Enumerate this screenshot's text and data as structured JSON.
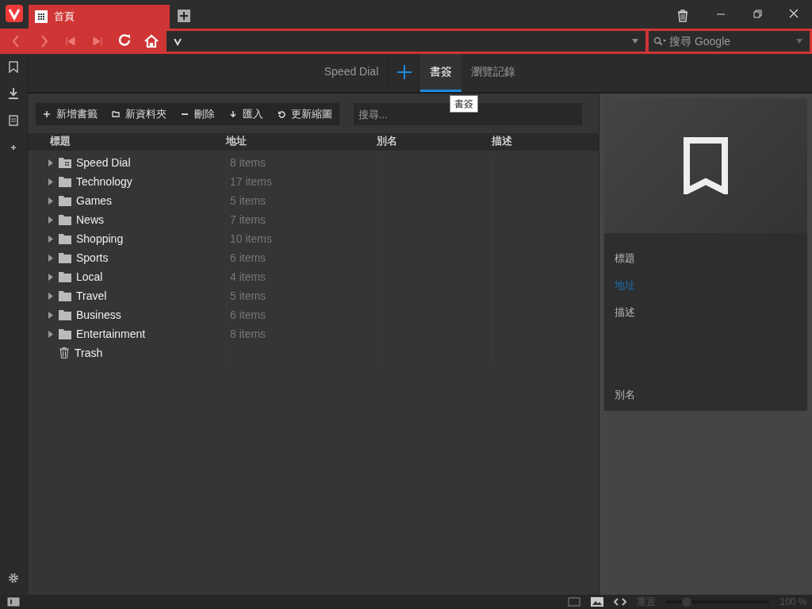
{
  "browser_tab": {
    "title": "首頁",
    "selected": true
  },
  "search_engine": {
    "placeholder": "搜尋 Google"
  },
  "panel_tabs": [
    {
      "label": "Speed Dial",
      "selected": false
    },
    {
      "label": "書簽",
      "selected": true
    },
    {
      "label": "瀏覽記錄",
      "selected": false
    }
  ],
  "tooltip": "書簽",
  "toolbar": [
    {
      "label": "新增書籤",
      "kind": "add"
    },
    {
      "label": "新資料夾",
      "kind": "folder"
    },
    {
      "label": "刪除",
      "kind": "delete"
    },
    {
      "label": "匯入",
      "kind": "import"
    },
    {
      "label": "更新縮圖",
      "kind": "refresh"
    }
  ],
  "bookmark_search": {
    "placeholder": "搜尋..."
  },
  "columns": [
    "標題",
    "地址",
    "別名",
    "描述"
  ],
  "rows": [
    {
      "title": "Speed Dial",
      "count": "8 items",
      "kind": "speeddial",
      "expanded": false
    },
    {
      "title": "Technology",
      "count": "17 items",
      "kind": "folder",
      "expanded": false
    },
    {
      "title": "Games",
      "count": "5 items",
      "kind": "folder",
      "expanded": false
    },
    {
      "title": "News",
      "count": "7 items",
      "kind": "folder",
      "expanded": false
    },
    {
      "title": "Shopping",
      "count": "10 items",
      "kind": "folder",
      "expanded": false
    },
    {
      "title": "Sports",
      "count": "6 items",
      "kind": "folder",
      "expanded": false
    },
    {
      "title": "Local",
      "count": "4 items",
      "kind": "folder",
      "expanded": false
    },
    {
      "title": "Travel",
      "count": "5 items",
      "kind": "folder",
      "expanded": false
    },
    {
      "title": "Business",
      "count": "6 items",
      "kind": "folder",
      "expanded": false
    },
    {
      "title": "Entertainment",
      "count": "8 items",
      "kind": "folder",
      "expanded": false
    },
    {
      "title": "Trash",
      "kind": "trash"
    }
  ],
  "details": [
    {
      "label": "標題",
      "selected": false
    },
    {
      "label": "地址",
      "selected": true
    },
    {
      "label": "描述",
      "selected": false
    },
    {
      "label": "別名",
      "selected": false
    }
  ],
  "status_bar": {
    "reset": "重置",
    "zoom": {
      "level": 0.2
    },
    "zoom_reading": "100 %"
  }
}
